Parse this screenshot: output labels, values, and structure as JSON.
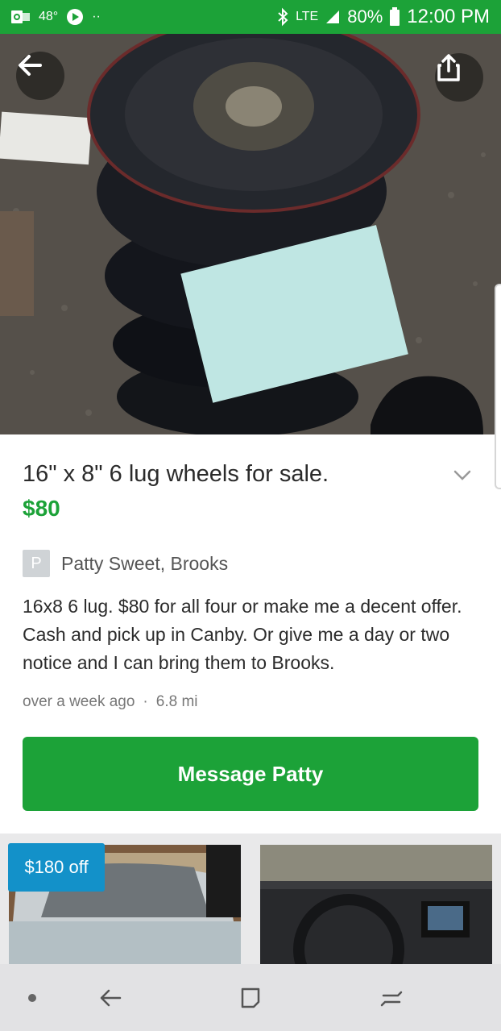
{
  "status_bar": {
    "temperature": "48°",
    "network": "LTE",
    "battery": "80%",
    "time": "12:00 PM"
  },
  "listing": {
    "title": "16\" x 8\" 6 lug wheels for sale.",
    "price": "$80",
    "seller_initial": "P",
    "seller": "Patty Sweet, Brooks",
    "description": "16x8 6 lug. $80 for all four or make me a decent offer. Cash and pick up in Canby. Or give me a day or two notice and I can bring them to Brooks.",
    "posted": "over a week ago",
    "separator": "·",
    "distance": "6.8 mi",
    "message_button": "Message Patty"
  },
  "related": {
    "badge": "$180 off"
  },
  "colors": {
    "brand_green": "#1ca238",
    "badge_blue": "#1391c9"
  },
  "icons": [
    "outlook-icon",
    "play-icon",
    "bluetooth-icon",
    "signal-icon",
    "battery-icon",
    "back-arrow-icon",
    "share-icon",
    "chevron-down-icon",
    "nav-dot-icon",
    "nav-back-icon",
    "nav-recents-icon",
    "nav-overview-icon"
  ]
}
